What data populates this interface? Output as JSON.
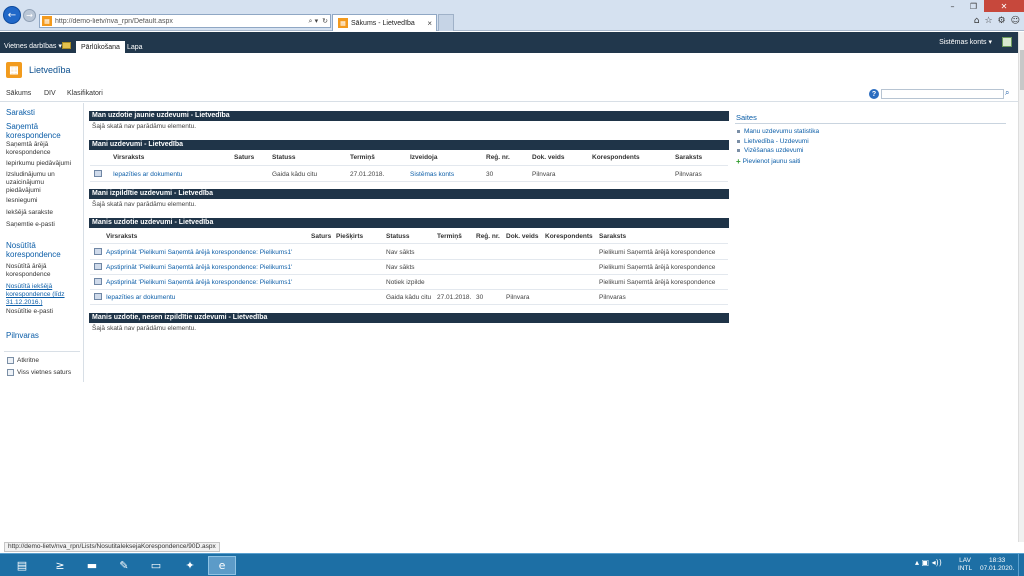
{
  "browser": {
    "url": "http://demo-lietv/nva_rpn/Default.aspx",
    "tab_title": "Sākums - Lietvedība",
    "status_url": "http://demo-lietv/nva_rpn/Lists/NosutitaIeksejaKorespondence/90D.aspx"
  },
  "ribbon": {
    "site_actions": "Vietnes darbības ▾",
    "tabs": [
      "Pārlūkošana",
      "Lapa"
    ],
    "user": "Sistēmas konts ▾"
  },
  "site": {
    "title": "Lietvedība"
  },
  "topnav": {
    "items": [
      "Sākums",
      "DIV",
      "Klasifikatori"
    ]
  },
  "leftnav": {
    "heading": "Saraksti",
    "groups": [
      {
        "title": "Saņemtā korespondence",
        "items": [
          "Saņemtā ārējā korespondence",
          "Iepirkumu piedāvājumi",
          "Izsludinājumu un uzaicinājumu piedāvājumi",
          "Iesniegumi",
          "Iekšējā sarakste",
          "Saņemtie e-pasti"
        ]
      },
      {
        "title": "Nosūtītā korespondence",
        "items": [
          "Nosūtītā ārējā korespondence",
          "Nosūtītā iekšējā korespondence (līdz 31.12.2016.)",
          "Nosūtītie e-pasti"
        ]
      }
    ],
    "pilnvaras": "Pilnvaras",
    "footer": [
      "Atkritne",
      "Viss vietnes saturs"
    ]
  },
  "webparts": {
    "empty_text": "Šajā skatā nav parādāmu elementu.",
    "wp1": {
      "title": "Man uzdotie jaunie uzdevumi - Lietvedība"
    },
    "wp2": {
      "title": "Mani uzdevumi - Lietvedība",
      "headers": [
        "Virsraksts",
        "Saturs",
        "Statuss",
        "Termiņš",
        "Izveidoja",
        "Reģ. nr.",
        "Dok. veids",
        "Korespondents",
        "Saraksts"
      ],
      "rows": [
        {
          "title": "Iepazīties ar dokumentu",
          "status": "Gaida kādu citu",
          "due": "27.01.2018.",
          "created_by": "Sistēmas konts",
          "reg": "30",
          "doc_type": "Pilnvara",
          "list": "Pilnvaras"
        }
      ]
    },
    "wp3": {
      "title": "Mani izpildītie uzdevumi - Lietvedība"
    },
    "wp4": {
      "title": "Manis uzdotie uzdevumi - Lietvedība",
      "headers": [
        "Virsraksts",
        "Saturs",
        "Piešķirts",
        "Statuss",
        "Termiņš",
        "Reģ. nr.",
        "Dok. veids",
        "Korespondents",
        "Saraksts"
      ],
      "rows": [
        {
          "title": "Apstiprināt 'Pielikumi Saņemtā ārējā korespondence: Pielikums1'",
          "status": "Nav sākts",
          "due": "",
          "reg": "",
          "doc_type": "",
          "list": "Pielikumi Saņemtā ārējā korespondence"
        },
        {
          "title": "Apstiprināt 'Pielikumi Saņemtā ārējā korespondence: Pielikums1'",
          "status": "Nav sākts",
          "due": "",
          "reg": "",
          "doc_type": "",
          "list": "Pielikumi Saņemtā ārējā korespondence"
        },
        {
          "title": "Apstiprināt 'Pielikumi Saņemtā ārējā korespondence: Pielikums1'",
          "status": "Notiek izpilde",
          "due": "",
          "reg": "",
          "doc_type": "",
          "list": "Pielikumi Saņemtā ārējā korespondence"
        },
        {
          "title": "Iepazīties ar dokumentu",
          "status": "Gaida kādu citu",
          "due": "27.01.2018.",
          "reg": "30",
          "doc_type": "Pilnvara",
          "list": "Pilnvaras"
        }
      ]
    },
    "wp5": {
      "title": "Manis uzdotie, nesen izpildītie uzdevumi - Lietvedība"
    }
  },
  "links": {
    "heading": "Saites",
    "items": [
      "Manu uzdevumu statistika",
      "Lietvedība - Uzdevumi",
      "Vizēšanas uzdevumi"
    ],
    "add": "Pievienot jaunu saiti"
  },
  "taskbar": {
    "lang": [
      "LAV",
      "INTL"
    ],
    "time": "18:33",
    "date": "07.01.2020."
  },
  "colors": {
    "header_bar": "#1f3448",
    "ribbon": "#21374c",
    "link": "#0c5ea8",
    "taskbar": "#1d6fa5"
  }
}
